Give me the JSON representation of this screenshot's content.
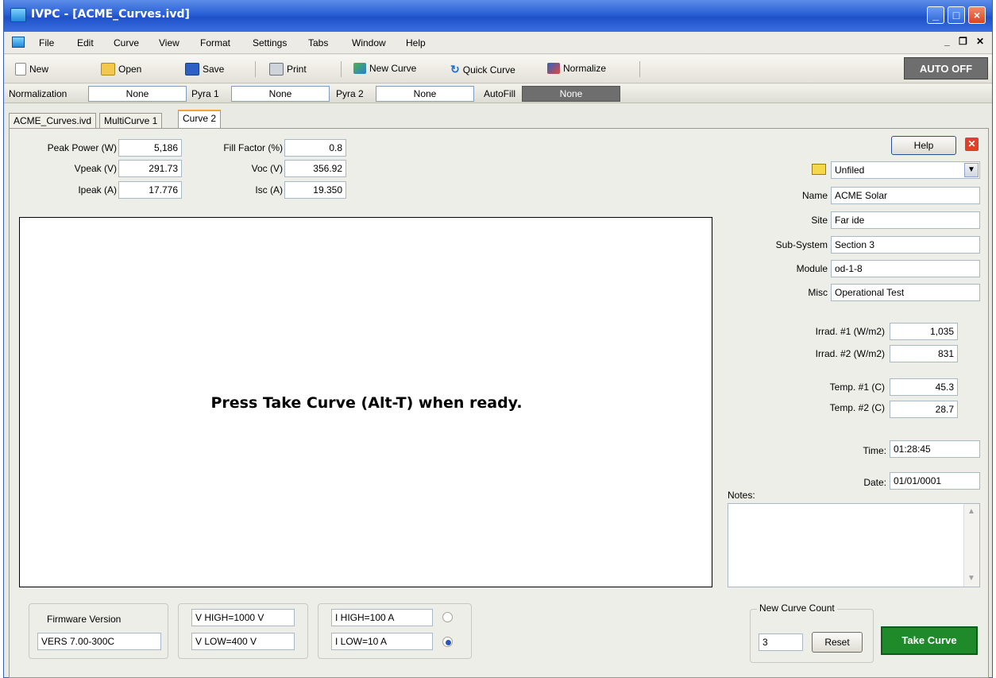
{
  "window": {
    "title": "IVPC - [ACME_Curves.ivd]"
  },
  "menu": [
    "File",
    "Edit",
    "Curve",
    "View",
    "Format",
    "Settings",
    "Tabs",
    "Window",
    "Help"
  ],
  "toolbar": {
    "new_label": "New",
    "open_label": "Open",
    "save_label": "Save",
    "print_label": "Print",
    "new_curve_label": "New Curve",
    "quick_curve_label": "Quick Curve",
    "normalize_label": "Normalize",
    "auto_status": "AUTO OFF"
  },
  "normbar": {
    "normalization_label": "Normalization",
    "normalization_value": "None",
    "pyra1_label": "Pyra 1",
    "pyra1_value": "None",
    "pyra2_label": "Pyra 2",
    "pyra2_value": "None",
    "autofill_label": "AutoFill",
    "autofill_value": "None"
  },
  "tabs": [
    "ACME_Curves.ivd",
    "MultiCurve 1",
    "Curve 2"
  ],
  "metrics": {
    "peak_power_label": "Peak Power (W)",
    "peak_power": "5,186",
    "vpeak_label": "Vpeak (V)",
    "vpeak": "291.73",
    "ipeak_label": "Ipeak (A)",
    "ipeak": "17.776",
    "fill_factor_label": "Fill Factor (%)",
    "fill_factor": "0.8",
    "voc_label": "Voc (V)",
    "voc": "356.92",
    "isc_label": "Isc (A)",
    "isc": "19.350"
  },
  "plot": {
    "message": "Press Take Curve (Alt-T) when ready."
  },
  "panel": {
    "help_label": "Help",
    "folder_value": "Unfiled",
    "name_label": "Name",
    "name": "ACME Solar",
    "site_label": "Site",
    "site": "Far ide",
    "subsystem_label": "Sub-System",
    "subsystem": "Section 3",
    "module_label": "Module",
    "module": "od-1-8",
    "misc_label": "Misc",
    "misc": "Operational Test",
    "irrad1_label": "Irrad. #1 (W/m2)",
    "irrad1": "1,035",
    "irrad2_label": "Irrad. #2 (W/m2)",
    "irrad2": "831",
    "temp1_label": "Temp. #1 (C)",
    "temp1": "45.3",
    "temp2_label": "Temp. #2 (C)",
    "temp2": "28.7",
    "time_label": "Time:",
    "time": "01:28:45",
    "date_label": "Date:",
    "date": "01/01/0001",
    "notes_label": "Notes:"
  },
  "bottom": {
    "firmware_label": "Firmware Version",
    "firmware": "VERS 7.00-300C",
    "v_high": "V HIGH=1000 V",
    "v_low": "V LOW=400 V",
    "i_high": "I HIGH=100 A",
    "i_low": "I LOW=10 A",
    "curve_count_label": "New Curve Count",
    "curve_count": "3",
    "reset_label": "Reset",
    "take_curve_label": "Take Curve"
  }
}
